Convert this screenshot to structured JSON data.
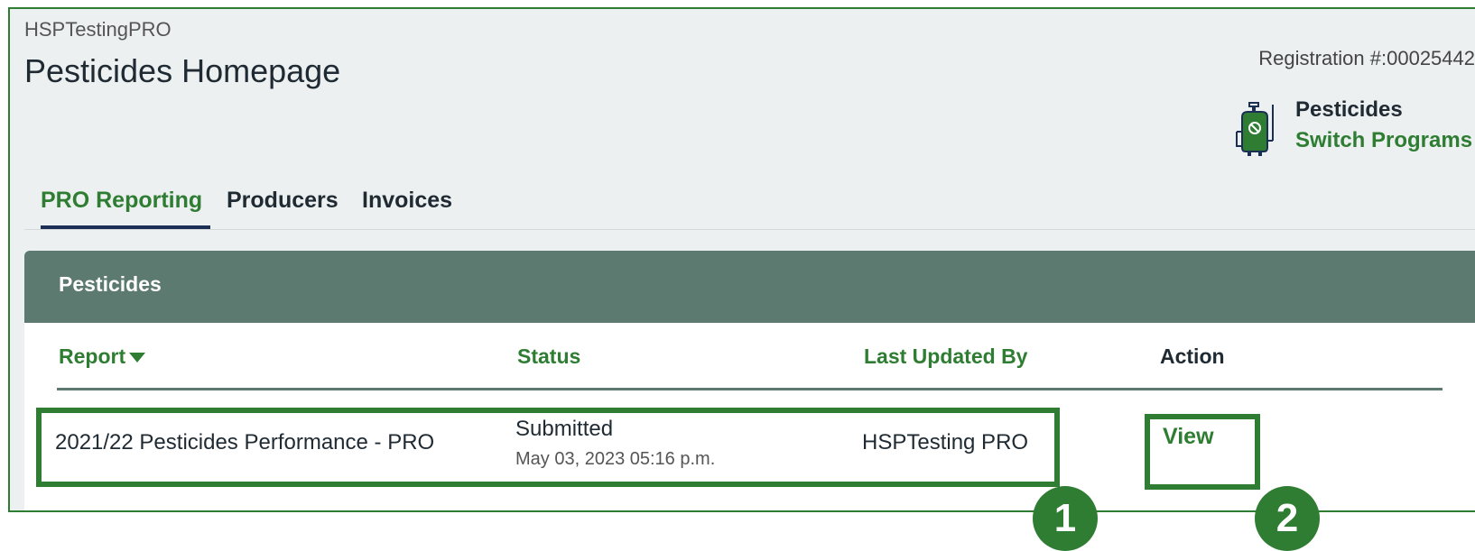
{
  "header": {
    "org_name": "HSPTestingPRO",
    "page_title": "Pesticides Homepage",
    "registration": "Registration #:00025442",
    "program_name": "Pesticides",
    "switch_programs": "Switch Programs",
    "program_icon": "sprayer-icon"
  },
  "tabs": [
    {
      "label": "PRO Reporting",
      "active": true
    },
    {
      "label": "Producers",
      "active": false
    },
    {
      "label": "Invoices",
      "active": false
    }
  ],
  "card": {
    "title": "Pesticides",
    "columns": {
      "report": "Report",
      "status": "Status",
      "last_updated_by": "Last Updated By",
      "action": "Action"
    },
    "rows": [
      {
        "report": "2021/22 Pesticides Performance - PRO",
        "status": "Submitted",
        "status_date": "May 03, 2023 05:16 p.m.",
        "last_updated_by": "HSPTesting PRO",
        "action": "View"
      }
    ]
  },
  "callouts": [
    "1",
    "2"
  ],
  "colors": {
    "accent": "#2e7d32",
    "card_header": "#5d7a70",
    "page_bg": "#edf0f1",
    "tab_underline": "#1b2f55"
  }
}
